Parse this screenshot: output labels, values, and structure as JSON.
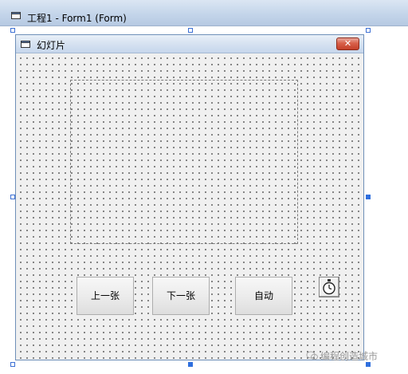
{
  "outer_window": {
    "title": "工程1 - Form1 (Form)"
  },
  "form": {
    "title": "幻灯片",
    "buttons": {
      "prev": "上一张",
      "next": "下一张",
      "auto": "自动"
    }
  },
  "watermark": {
    "text": "编程创造城市"
  },
  "colors": {
    "titlebar": "#c4d5ea",
    "form_background": "#f0f0f0",
    "selection_handle": "#3b6fd4",
    "close_button": "#d8604a"
  }
}
